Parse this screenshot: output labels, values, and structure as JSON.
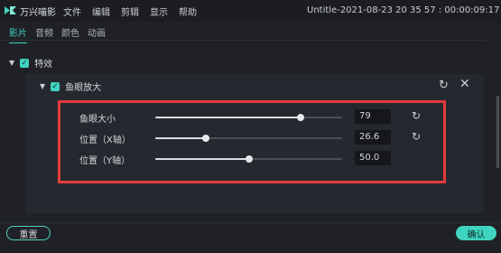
{
  "app": {
    "name": "万兴喵影",
    "window_title": "Untitle-2021-08-23 20 35 57 : 00:00:09:17",
    "brand_color": "#3fd4bf",
    "logo_icon": "wondershare-filmora-logo"
  },
  "menu": [
    "文件",
    "编辑",
    "剪辑",
    "显示",
    "帮助"
  ],
  "tabs": [
    {
      "label": "影片",
      "active": true
    },
    {
      "label": "音频",
      "active": false
    },
    {
      "label": "颜色",
      "active": false
    },
    {
      "label": "动画",
      "active": false
    }
  ],
  "effects_section": {
    "label": "特效",
    "checked": true,
    "effect": {
      "label": "鱼眼放大",
      "checked": true,
      "params": [
        {
          "label": "鱼眼大小",
          "value": "79",
          "fraction": 0.78,
          "has_reset": true
        },
        {
          "label": "位置（X轴）",
          "value": "26.6",
          "fraction": 0.27,
          "has_reset": true
        },
        {
          "label": "位置（Y轴）",
          "value": "50.0",
          "fraction": 0.5,
          "has_reset": false
        }
      ]
    }
  },
  "footer": {
    "reset_label": "重置",
    "ok_label": "确认"
  },
  "highlight_color": "#e33b3b"
}
